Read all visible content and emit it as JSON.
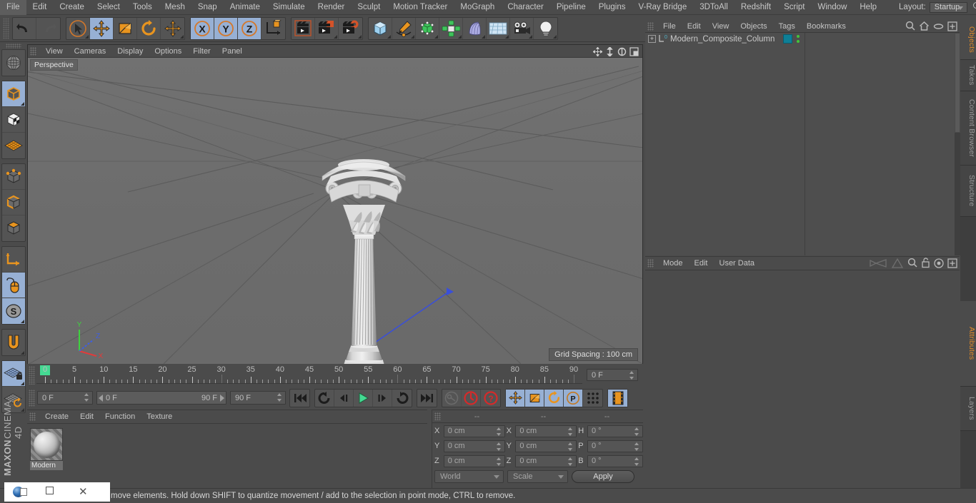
{
  "menubar": {
    "items": [
      "File",
      "Edit",
      "Create",
      "Select",
      "Tools",
      "Mesh",
      "Snap",
      "Animate",
      "Simulate",
      "Render",
      "Sculpt",
      "Motion Tracker",
      "MoGraph",
      "Character",
      "Pipeline",
      "Plugins",
      "V-Ray Bridge",
      "3DToAll",
      "Redshift",
      "Script",
      "Window",
      "Help"
    ],
    "layout_label": "Layout:",
    "layout_value": "Startup",
    "search_icon": "search-icon"
  },
  "toolbar": {
    "groups": [
      {
        "name": "history",
        "buttons": [
          {
            "name": "undo",
            "icon": "undo-arrow-icon",
            "state": "normal"
          },
          {
            "name": "redo",
            "icon": "redo-arrow-icon",
            "state": "disabled"
          }
        ]
      },
      {
        "name": "transform-tools",
        "buttons": [
          {
            "name": "live-selection",
            "icon": "cursor-circle-icon",
            "state": "normal"
          },
          {
            "name": "move",
            "icon": "move-arrows-icon",
            "state": "active"
          },
          {
            "name": "scale",
            "icon": "scale-box-icon",
            "state": "normal"
          },
          {
            "name": "rotate",
            "icon": "rotate-arc-icon",
            "state": "normal"
          },
          {
            "name": "move-duplicate",
            "icon": "move-arrows-icon",
            "state": "normal"
          }
        ]
      },
      {
        "name": "axis-locks",
        "buttons": [
          {
            "name": "lock-x",
            "icon": "x-axis-icon",
            "state": "active"
          },
          {
            "name": "lock-y",
            "icon": "y-axis-icon",
            "state": "active"
          },
          {
            "name": "lock-z",
            "icon": "z-axis-icon",
            "state": "active"
          },
          {
            "name": "world-object-coords",
            "icon": "world-axis-cube-icon",
            "state": "normal"
          }
        ]
      },
      {
        "name": "render",
        "buttons": [
          {
            "name": "render-view",
            "icon": "clapper-view-icon",
            "state": "normal"
          },
          {
            "name": "render-to-picture-viewer",
            "icon": "clapper-picture-icon",
            "state": "normal"
          },
          {
            "name": "render-settings",
            "icon": "clapper-gear-icon",
            "state": "normal"
          }
        ]
      },
      {
        "name": "create",
        "buttons": [
          {
            "name": "primitive-cube",
            "icon": "cube-blue-icon",
            "state": "normal"
          },
          {
            "name": "spline-pen",
            "icon": "pen-spline-icon",
            "state": "normal"
          },
          {
            "name": "generator",
            "icon": "green-cube-points-icon",
            "state": "normal"
          },
          {
            "name": "mograph",
            "icon": "mograph-cluster-icon",
            "state": "normal"
          },
          {
            "name": "deformer",
            "icon": "bend-deformer-icon",
            "state": "normal"
          },
          {
            "name": "environment",
            "icon": "floor-grid-icon",
            "state": "normal"
          },
          {
            "name": "camera",
            "icon": "camera-icon",
            "state": "normal"
          },
          {
            "name": "light",
            "icon": "lightbulb-icon",
            "state": "normal"
          }
        ]
      }
    ]
  },
  "left_toolbar": {
    "groups": [
      {
        "name": "uv",
        "buttons": [
          {
            "name": "make-editable-globe",
            "icon": "globe-wire-icon",
            "state": "normal"
          }
        ]
      },
      {
        "name": "modes",
        "buttons": [
          {
            "name": "model-mode",
            "icon": "model-cube-icon",
            "state": "active"
          },
          {
            "name": "texture-mode",
            "icon": "texture-cube-icon",
            "state": "normal"
          },
          {
            "name": "workplane-mode",
            "icon": "workplane-grid-icon",
            "state": "normal"
          }
        ]
      },
      {
        "name": "components",
        "buttons": [
          {
            "name": "points-mode",
            "icon": "points-cube-icon",
            "state": "normal"
          },
          {
            "name": "edges-mode",
            "icon": "edges-cube-icon",
            "state": "normal"
          },
          {
            "name": "polygons-mode",
            "icon": "polygons-cube-icon",
            "state": "normal"
          }
        ]
      },
      {
        "name": "axis",
        "buttons": [
          {
            "name": "enable-axis",
            "icon": "axis-corner-icon",
            "state": "normal"
          },
          {
            "name": "viewport-solo-mouse",
            "icon": "mouse-icon",
            "state": "active"
          },
          {
            "name": "soft-selection",
            "icon": "s-circle-icon",
            "state": "active"
          }
        ]
      },
      {
        "name": "snap",
        "buttons": [
          {
            "name": "enable-snap",
            "icon": "magnet-icon",
            "state": "normal"
          }
        ]
      },
      {
        "name": "workplane",
        "buttons": [
          {
            "name": "lock-workplane",
            "icon": "grid-lock-icon",
            "state": "active"
          },
          {
            "name": "align-workplane",
            "icon": "grid-rotate-icon",
            "state": "normal"
          }
        ]
      }
    ],
    "brand_line1": "MAXON",
    "brand_line2": "CINEMA 4D"
  },
  "viewport": {
    "menu_items": [
      "View",
      "Cameras",
      "Display",
      "Options",
      "Filter",
      "Panel"
    ],
    "nav_icons": [
      "pan-icon",
      "zoom-icon",
      "rotate-icon",
      "maximize-icon"
    ],
    "label": "Perspective",
    "grid_spacing": "Grid Spacing : 100 cm",
    "axis_labels": {
      "x": "X",
      "y": "Y",
      "z": "Z"
    },
    "axis_colors": {
      "x": "#e03b3b",
      "y": "#3fd13f",
      "z": "#3f5fe0"
    },
    "object_description": "Modern composite Corinthian column with fluted shaft"
  },
  "timeline": {
    "ticks": [
      {
        "label": "0",
        "frame": 0
      },
      {
        "label": "5",
        "frame": 5
      },
      {
        "label": "10",
        "frame": 10
      },
      {
        "label": "15",
        "frame": 15
      },
      {
        "label": "20",
        "frame": 20
      },
      {
        "label": "25",
        "frame": 25
      },
      {
        "label": "30",
        "frame": 30
      },
      {
        "label": "35",
        "frame": 35
      },
      {
        "label": "40",
        "frame": 40
      },
      {
        "label": "45",
        "frame": 45
      },
      {
        "label": "50",
        "frame": 50
      },
      {
        "label": "55",
        "frame": 55
      },
      {
        "label": "60",
        "frame": 60
      },
      {
        "label": "65",
        "frame": 65
      },
      {
        "label": "70",
        "frame": 70
      },
      {
        "label": "75",
        "frame": 75
      },
      {
        "label": "80",
        "frame": 80
      },
      {
        "label": "85",
        "frame": 85
      },
      {
        "label": "90",
        "frame": 90
      }
    ],
    "range_min": 0,
    "range_max": 90,
    "playhead_frame": 0,
    "playhead_color": "#44d992",
    "current_frame_field": "0 F"
  },
  "playbar": {
    "current_frame": "0 F",
    "range_start": "0 F",
    "range_end": "90 F",
    "end_frame": "90 F",
    "transport": [
      {
        "name": "go-to-start",
        "icon": "skip-back-icon"
      },
      {
        "name": "previous-key",
        "icon": "prev-key-icon"
      },
      {
        "name": "step-back",
        "icon": "step-back-icon"
      },
      {
        "name": "play",
        "icon": "play-icon"
      },
      {
        "name": "step-forward",
        "icon": "step-forward-icon"
      },
      {
        "name": "next-key",
        "icon": "next-key-icon"
      },
      {
        "name": "go-to-end",
        "icon": "skip-forward-icon"
      }
    ],
    "record_buttons": [
      {
        "name": "autokey",
        "icon": "key-icon",
        "state": "disabled"
      },
      {
        "name": "record-active-objects",
        "icon": "record-circle-icon",
        "state": "normal"
      },
      {
        "name": "record-question",
        "icon": "question-circle-icon",
        "state": "normal"
      }
    ],
    "key_toggles": [
      {
        "name": "key-position",
        "icon": "move-arrows-icon",
        "state": "active"
      },
      {
        "name": "key-scale",
        "icon": "scale-box-icon",
        "state": "active"
      },
      {
        "name": "key-rotation",
        "icon": "rotate-arc-icon",
        "state": "active"
      },
      {
        "name": "key-parameter",
        "icon": "p-circle-icon",
        "state": "active"
      },
      {
        "name": "key-pla",
        "icon": "dots-grid-icon",
        "state": "normal"
      }
    ],
    "extra": [
      {
        "name": "timeline-filmstrip",
        "icon": "filmstrip-icon",
        "state": "active"
      }
    ]
  },
  "material_manager": {
    "menu_items": [
      "Create",
      "Edit",
      "Function",
      "Texture"
    ],
    "materials": [
      {
        "name": "Modern",
        "type": "standard-material"
      }
    ]
  },
  "coordinates": {
    "header_dashes": [
      "--",
      "--",
      "--"
    ],
    "rows": [
      {
        "pos_label": "X",
        "pos_value": "0 cm",
        "size_label": "X",
        "size_value": "0 cm",
        "rot_label": "H",
        "rot_value": "0 °"
      },
      {
        "pos_label": "Y",
        "pos_value": "0 cm",
        "size_label": "Y",
        "size_value": "0 cm",
        "rot_label": "P",
        "rot_value": "0 °"
      },
      {
        "pos_label": "Z",
        "pos_value": "0 cm",
        "size_label": "Z",
        "size_value": "0 cm",
        "rot_label": "B",
        "rot_value": "0 °"
      }
    ],
    "system_select": "World",
    "mode_select": "Scale",
    "apply_label": "Apply"
  },
  "object_manager": {
    "menu_items": [
      "File",
      "Edit",
      "View",
      "Objects",
      "Tags",
      "Bookmarks"
    ],
    "header_icons": [
      "search-icon",
      "home-icon",
      "eye-icon",
      "plus-box-icon"
    ],
    "objects": [
      {
        "name": "Modern_Composite_Column",
        "expandable": true,
        "tag_color": "#0e7f96",
        "has_green_dots": true
      }
    ]
  },
  "attribute_manager": {
    "menu_items": [
      "Mode",
      "Edit",
      "User Data"
    ],
    "header_icons": [
      "left-arrow-icon",
      "up-arrow-icon",
      "search-icon",
      "lock-icon",
      "target-icon",
      "plus-box-icon"
    ]
  },
  "right_tabs": [
    {
      "label": "Objects",
      "active": true
    },
    {
      "label": "Takes",
      "active": false
    },
    {
      "label": "Content Browser",
      "active": false
    },
    {
      "label": "Structure",
      "active": false
    },
    {
      "label": "Attributes",
      "active": true
    },
    {
      "label": "Layers",
      "active": false
    }
  ],
  "statusbar": {
    "message": "move elements. Hold down SHIFT to quantize movement / add to the selection in point mode, CTRL to remove."
  },
  "taskbar": {
    "items": [
      "c4d-orb-icon",
      "restore-icon",
      "close-icon"
    ]
  }
}
